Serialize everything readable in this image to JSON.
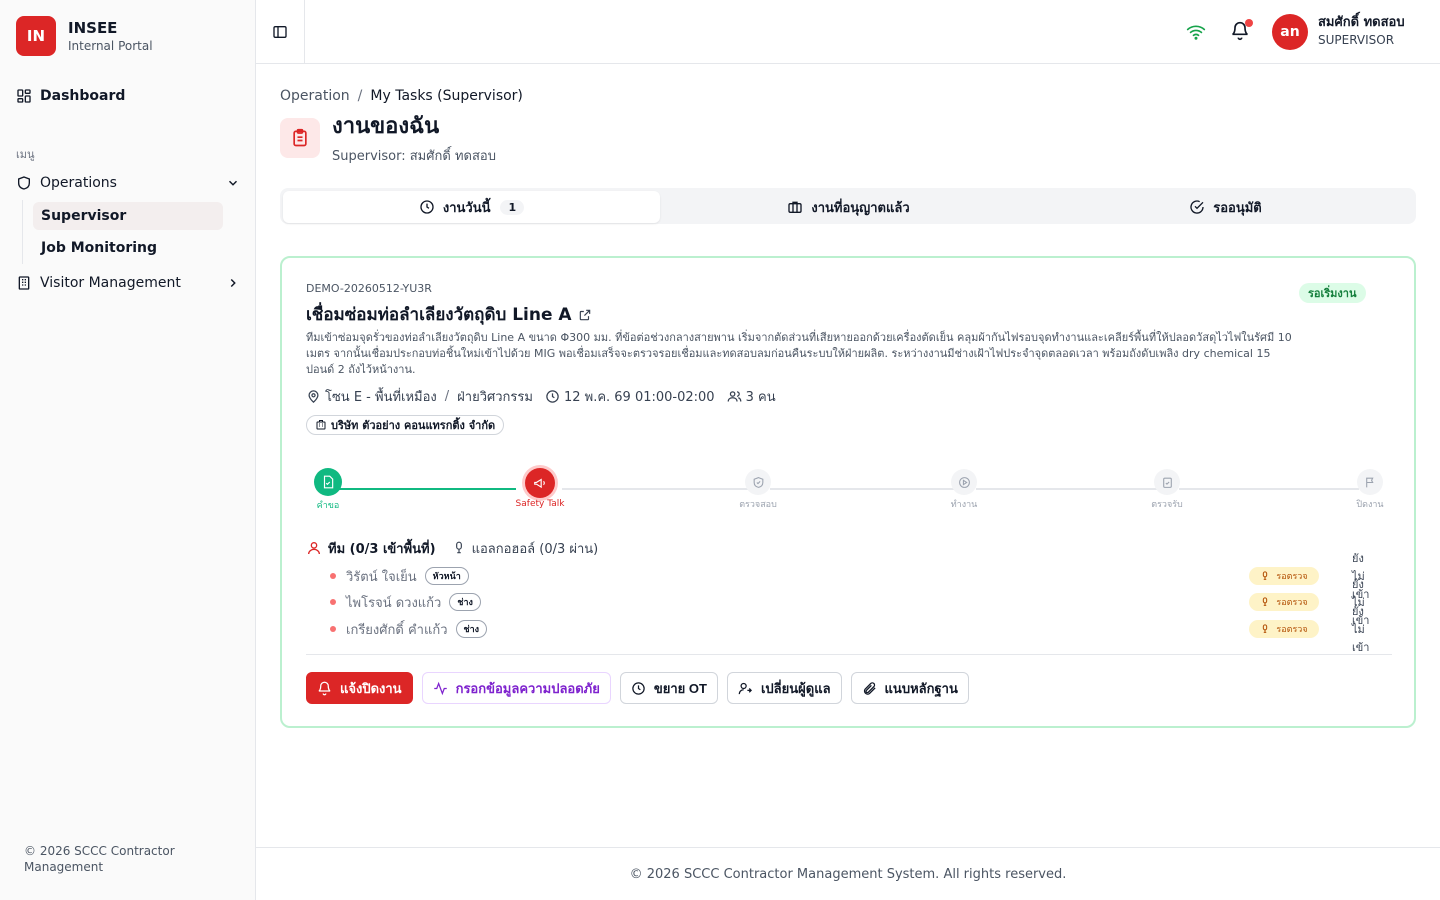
{
  "brand": {
    "logo": "IN",
    "title": "INSEE",
    "subtitle": "Internal Portal"
  },
  "sidebar": {
    "dashboard": "Dashboard",
    "menu_label": "เมนู",
    "operations": "Operations",
    "sub_items": [
      "Supervisor",
      "Job Monitoring"
    ],
    "visitor": "Visitor Management",
    "footer": "© 2026 SCCC Contractor Management"
  },
  "header": {
    "avatar": "an",
    "user_name": "สมศักดิ์ ทดสอบ",
    "user_role": "SUPERVISOR"
  },
  "breadcrumb": {
    "parent": "Operation",
    "separator": "/",
    "current": "My Tasks (Supervisor)"
  },
  "page": {
    "title": "งานของฉัน",
    "subtitle": "Supervisor: สมศักดิ์ ทดสอบ"
  },
  "tabs": [
    {
      "label": "งานวันนี้",
      "count": "1"
    },
    {
      "label": "งานที่อนุญาตแล้ว"
    },
    {
      "label": "รออนุมัติ"
    }
  ],
  "task": {
    "code": "DEMO-20260512-YU3R",
    "title": "เชื่อมซ่อมท่อลำเลียงวัตถุดิบ Line A",
    "status": "รอเริ่มงาน",
    "description": "ทีมเข้าซ่อมจุดรั่วของท่อลำเลียงวัตถุดิบ Line A ขนาด Φ300 มม. ที่ข้อต่อช่วงกลางสายพาน เริ่มจากตัดส่วนที่เสียหายออกด้วยเครื่องตัดเย็น คลุมผ้ากันไฟรอบจุดทำงานและเคลียร์พื้นที่ให้ปลอดวัสดุไวไฟในรัศมี 10 เมตร จากนั้นเชื่อมประกอบท่อชิ้นใหม่เข้าไปด้วย MIG พอเชื่อมเสร็จจะตรวจรอยเชื่อมและทดสอบลมก่อนคืนระบบให้ฝ่ายผลิต. ระหว่างงานมีช่างเฝ้าไฟประจำจุดตลอดเวลา พร้อมถังดับเพลิง dry chemical 15 ปอนด์ 2 ถังไว้หน้างาน.",
    "zone": "โซน E - พื้นที่เหมือง",
    "zone_sep": "/",
    "department": "ฝ่ายวิศวกรรม",
    "datetime": "12 พ.ค. 69 01:00-02:00",
    "people": "3 คน",
    "company": "บริษัท ตัวอย่าง คอนแทรกติ้ง จำกัด",
    "steps": [
      "คำขอ",
      "Safety Talk",
      "ตรวจสอบ",
      "ทำงาน",
      "ตรวจรับ",
      "ปิดงาน"
    ],
    "current_step": 1,
    "team_label": "ทีม (0/3 เข้าพื้นที่)",
    "alcohol_label": "แอลกอฮอล์ (0/3 ผ่าน)",
    "members": [
      {
        "name": "วิรัตน์ ใจเย็น",
        "role": "หัวหน้า",
        "check": "รอตรวจ",
        "entry": "ยังไม่เข้า"
      },
      {
        "name": "ไพโรจน์ ดวงแก้ว",
        "role": "ช่าง",
        "check": "รอตรวจ",
        "entry": "ยังไม่เข้า"
      },
      {
        "name": "เกรียงศักดิ์ คำแก้ว",
        "role": "ช่าง",
        "check": "รอตรวจ",
        "entry": "ยังไม่เข้า"
      }
    ]
  },
  "actions": {
    "notify_close": "แจ้งปิดงาน",
    "safety_data": "กรอกข้อมูลความปลอดภัย",
    "extend_ot": "ขยาย OT",
    "change_supervisor": "เปลี่ยนผู้ดูแล",
    "attach_evidence": "แนบหลักฐาน"
  },
  "footer": "© 2026 SCCC Contractor Management System. All rights reserved.",
  "colors": {
    "brand": "#dc2626",
    "success": "#10b981",
    "card_border": "#bbf0cf",
    "pending": "#fef3c7"
  }
}
